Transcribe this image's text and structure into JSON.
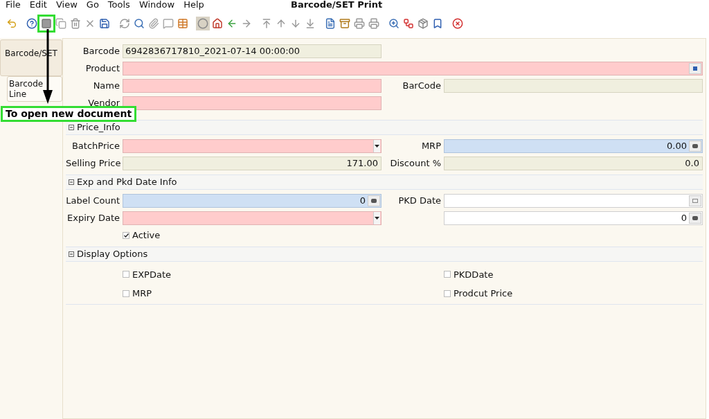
{
  "menu": [
    "File",
    "Edit",
    "View",
    "Go",
    "Tools",
    "Window",
    "Help"
  ],
  "window": {
    "title": "Barcode/SET Print"
  },
  "tabs": [
    {
      "label": "Barcode/SET",
      "selected": true
    },
    {
      "label": "Barcode Line",
      "selected": false
    }
  ],
  "annotation": {
    "text": "To open new document"
  },
  "sections": [
    {
      "rows": [
        {
          "left": {
            "label": "Barcode",
            "value": "6942836717810_2021-07-14 00:00:00",
            "kind": "readonly"
          }
        },
        {
          "wide": {
            "label": "Product",
            "kind": "mandatory",
            "button": {
              "kind": "lookup"
            }
          }
        },
        {
          "left": {
            "label": "Name",
            "kind": "mandatory"
          },
          "right": {
            "label": "BarCode",
            "kind": "readonly"
          }
        },
        {
          "left": {
            "label": "Vendor",
            "kind": "mandatory"
          }
        }
      ]
    },
    {
      "title": "Price_Info",
      "expanded": true,
      "rows": [
        {
          "left": {
            "label": "BatchPrice",
            "kind": "mandatory",
            "button": {
              "kind": "dropdown"
            }
          },
          "right": {
            "label": "MRP",
            "value": "0.00",
            "kind": "number",
            "button": {
              "kind": "calculator"
            }
          }
        },
        {
          "left": {
            "label": "Selling Price",
            "value": "171.00",
            "kind": "readonly"
          },
          "right": {
            "label": "Discount %",
            "value": "0.0",
            "kind": "readonly"
          }
        }
      ]
    },
    {
      "title": "Exp and Pkd Date Info",
      "expanded": true,
      "rows": [
        {
          "left": {
            "label": "Label Count",
            "value": "0",
            "kind": "number",
            "button": {
              "kind": "calculator"
            }
          },
          "right": {
            "label": "PKD Date",
            "kind": "plain",
            "button": {
              "kind": "calendar"
            }
          }
        },
        {
          "left": {
            "label": "Expiry Date",
            "kind": "mandatory",
            "button": {
              "kind": "dropdown"
            }
          },
          "right": {
            "value": "0",
            "kind": "plain",
            "button": {
              "kind": "calculator"
            }
          }
        }
      ],
      "checkboxes": [
        {
          "label": "Active",
          "checked": true
        }
      ]
    },
    {
      "title": "Display Options",
      "expanded": true,
      "checkboxes": [
        {
          "label": "EXPDate",
          "checked": false
        },
        {
          "label": "PKDDate",
          "checked": false
        },
        {
          "label": "MRP",
          "checked": false
        },
        {
          "label": "Prodcut Price",
          "checked": false
        }
      ]
    }
  ]
}
